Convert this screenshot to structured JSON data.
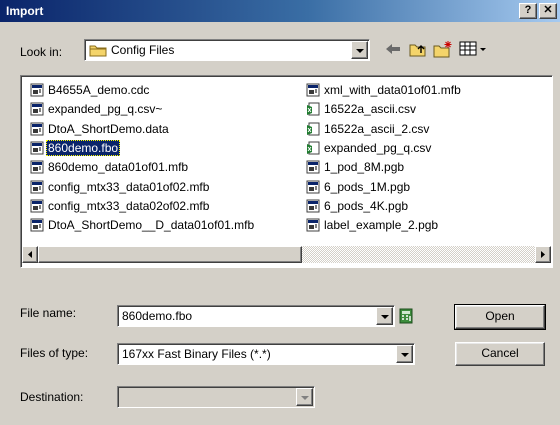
{
  "window": {
    "title": "Import",
    "help_label": "?",
    "close_label": "✕"
  },
  "look_in": {
    "label": "Look in:",
    "value": "Config Files"
  },
  "files": {
    "left": [
      {
        "name": "B4655A_demo.cdc",
        "icon": "data-file-icon"
      },
      {
        "name": "expanded_pg_q.csv~",
        "icon": "data-file-icon"
      },
      {
        "name": "DtoA_ShortDemo.data",
        "icon": "data-file-icon"
      },
      {
        "name": "860demo.fbo",
        "icon": "data-file-icon",
        "selected": true
      },
      {
        "name": "860demo_data01of01.mfb",
        "icon": "data-file-icon"
      },
      {
        "name": "config_mtx33_data01of02.mfb",
        "icon": "data-file-icon"
      },
      {
        "name": "config_mtx33_data02of02.mfb",
        "icon": "data-file-icon"
      },
      {
        "name": "DtoA_ShortDemo__D_data01of01.mfb",
        "icon": "data-file-icon"
      }
    ],
    "right": [
      {
        "name": "xml_with_data01of01.mfb",
        "icon": "data-file-icon"
      },
      {
        "name": "16522a_ascii.csv",
        "icon": "excel-file-icon"
      },
      {
        "name": "16522a_ascii_2.csv",
        "icon": "excel-file-icon"
      },
      {
        "name": "expanded_pg_q.csv",
        "icon": "excel-file-icon"
      },
      {
        "name": "1_pod_8M.pgb",
        "icon": "data-file-icon"
      },
      {
        "name": "6_pods_1M.pgb",
        "icon": "data-file-icon"
      },
      {
        "name": "6_pods_4K.pgb",
        "icon": "data-file-icon"
      },
      {
        "name": "label_example_2.pgb",
        "icon": "data-file-icon"
      }
    ]
  },
  "file_name": {
    "label": "File name:",
    "value": "860demo.fbo"
  },
  "file_type": {
    "label": "Files of type:",
    "value": "167xx Fast Binary Files (*.*)"
  },
  "destination": {
    "label": "Destination:",
    "value": ""
  },
  "buttons": {
    "open": "Open",
    "cancel": "Cancel"
  },
  "colors": {
    "titlebar_start": "#0a246a",
    "titlebar_end": "#a6caf0",
    "selection": "#0a246a",
    "dialog_bg": "#d4d0c8"
  }
}
